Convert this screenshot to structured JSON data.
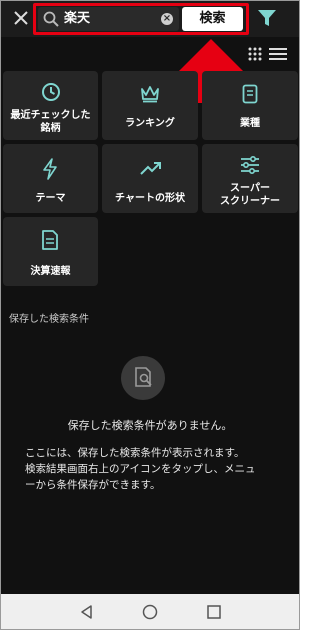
{
  "header": {
    "search_query": "楽天",
    "search_button_label": "検索"
  },
  "tiles": [
    {
      "label_line1": "最近チェックした",
      "label_line2": "銘柄"
    },
    {
      "label_line1": "ランキング",
      "label_line2": ""
    },
    {
      "label_line1": "業種",
      "label_line2": ""
    },
    {
      "label_line1": "テーマ",
      "label_line2": ""
    },
    {
      "label_line1": "チャートの形状",
      "label_line2": ""
    },
    {
      "label_line1": "スーパー",
      "label_line2": "スクリーナー"
    },
    {
      "label_line1": "決算速報",
      "label_line2": ""
    }
  ],
  "saved_section": {
    "title": "保存した検索条件",
    "empty_title": "保存した検索条件がありません。",
    "empty_desc_line1": "ここには、保存した検索条件が表示されます。",
    "empty_desc_line2": "検索結果画面右上のアイコンをタップし、メニュ",
    "empty_desc_line3": "ーから条件保存ができます。"
  },
  "colors": {
    "accent": "#7fd6d0",
    "highlight": "#e60012",
    "background": "#111111",
    "tile": "#262626"
  }
}
